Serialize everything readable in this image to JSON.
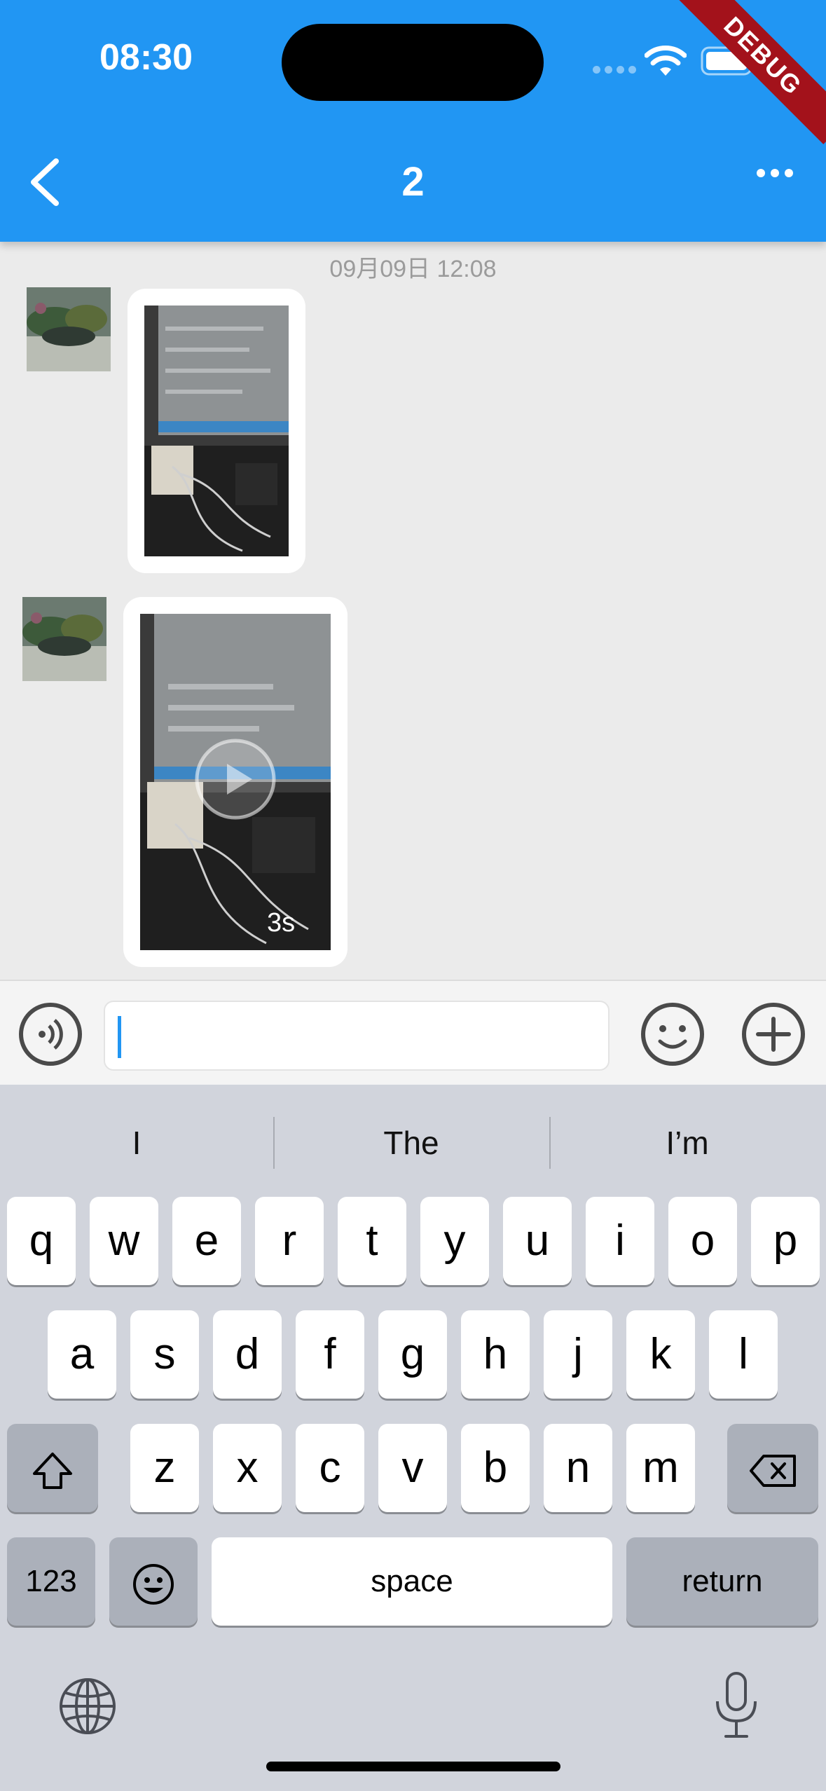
{
  "status_bar": {
    "time": "08:30",
    "debug_label": "DEBUG"
  },
  "nav": {
    "title": "2"
  },
  "chat": {
    "timestamp": "09月09日 12:08",
    "messages": [
      {
        "type": "image"
      },
      {
        "type": "video",
        "duration": "3s"
      }
    ]
  },
  "input_bar": {
    "value": ""
  },
  "keyboard": {
    "suggestions": [
      "I",
      "The",
      "I’m"
    ],
    "row1": [
      "q",
      "w",
      "e",
      "r",
      "t",
      "y",
      "u",
      "i",
      "o",
      "p"
    ],
    "row2": [
      "a",
      "s",
      "d",
      "f",
      "g",
      "h",
      "j",
      "k",
      "l"
    ],
    "row3": [
      "z",
      "x",
      "c",
      "v",
      "b",
      "n",
      "m"
    ],
    "numbers_label": "123",
    "space_label": "space",
    "return_label": "return"
  },
  "colors": {
    "accent": "#2196f3",
    "debug_ribbon": "#a3121b"
  },
  "icons": [
    "back-chevron-icon",
    "more-dots-icon",
    "voice-icon",
    "emoji-icon",
    "add-icon",
    "shift-icon",
    "backspace-icon",
    "emoji-keyboard-icon",
    "globe-icon",
    "mic-icon",
    "play-icon"
  ]
}
